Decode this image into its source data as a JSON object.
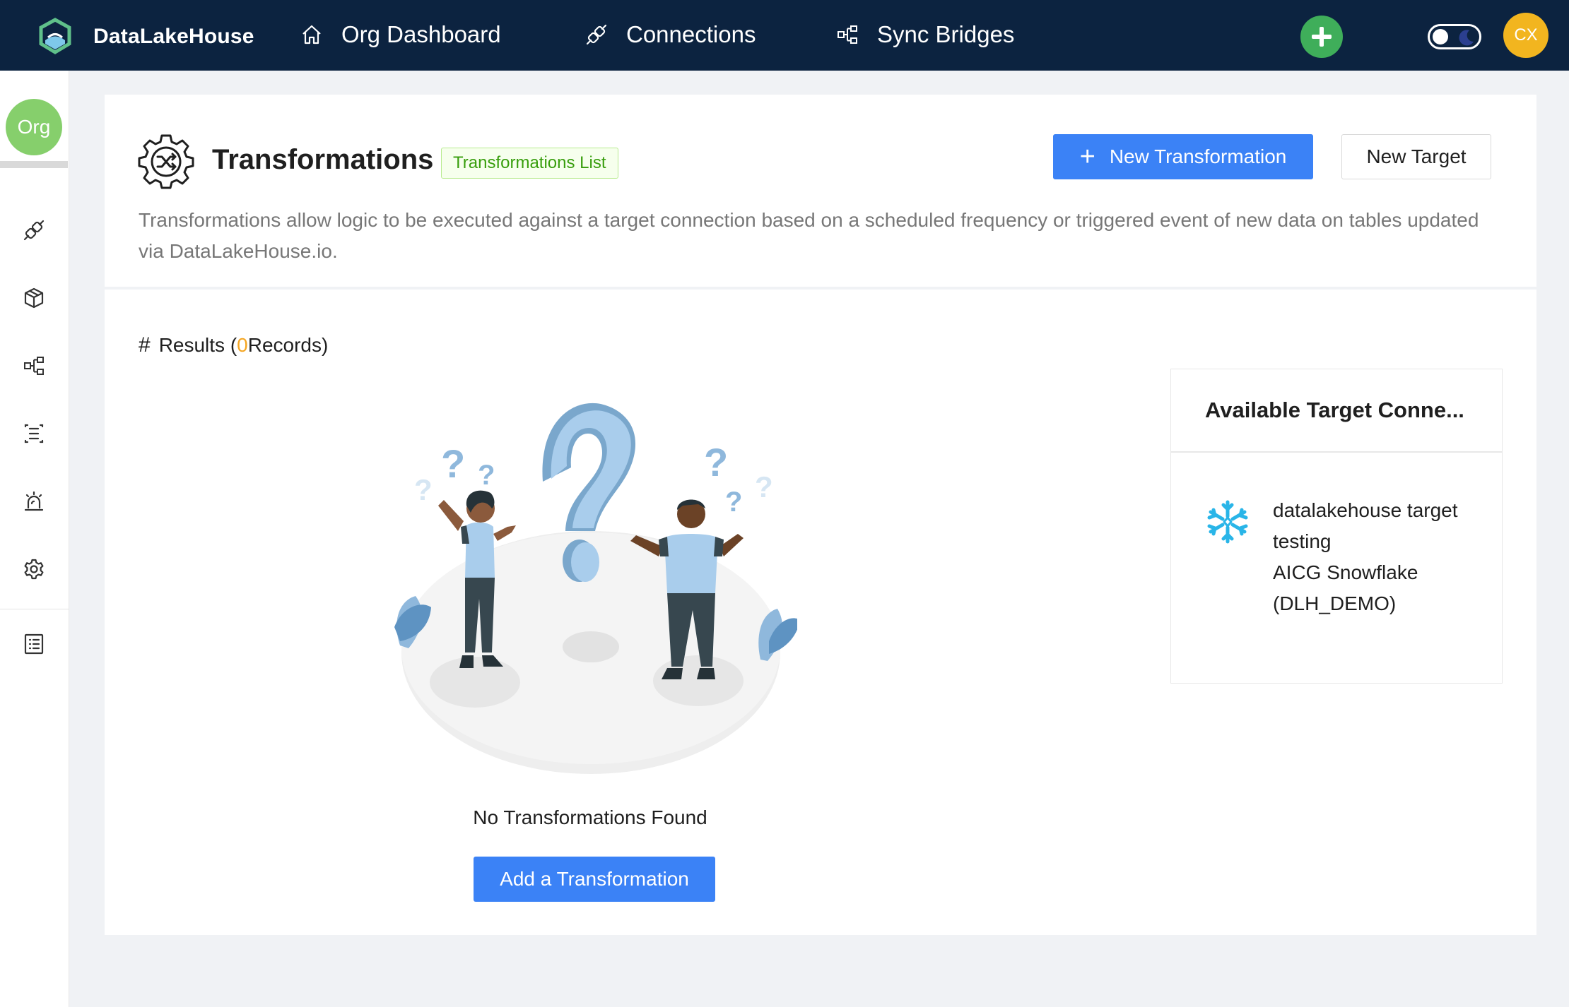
{
  "brand": {
    "name": "DataLakeHouse"
  },
  "nav": {
    "dashboard": "Org Dashboard",
    "connections": "Connections",
    "sync_bridges": "Sync Bridges"
  },
  "user": {
    "initials": "CX"
  },
  "sidebar": {
    "org_label": "Org",
    "items": [
      "connections-icon",
      "cube-icon",
      "sync-bridges-icon",
      "list-structure-icon",
      "alarm-icon",
      "gear-icon",
      "document-list-icon"
    ]
  },
  "page": {
    "title": "Transformations",
    "tag": "Transformations List",
    "new_transformation_label": "New Transformation",
    "new_target_label": "New Target",
    "description": "Transformations allow logic to be executed against a target connection based on a scheduled frequency or triggered event of new data on tables updated via DataLakeHouse.io."
  },
  "results": {
    "prefix": "Results (",
    "count": "0",
    "suffix": " Records)"
  },
  "empty_state": {
    "message": "No Transformations Found",
    "add_label": "Add a Transformation"
  },
  "target_panel": {
    "title": "Available Target Conne...",
    "items": [
      {
        "name": "datalakehouse target testing",
        "database": "AICG Snowflake (DLH_DEMO)",
        "icon": "snowflake-icon"
      }
    ]
  },
  "colors": {
    "topbar": "#0c2340",
    "primary": "#3b82f6",
    "add_green": "#3fae5a",
    "avatar_yellow": "#f2b51f",
    "org_green": "#86cf6c",
    "count_orange": "#f5a623"
  }
}
